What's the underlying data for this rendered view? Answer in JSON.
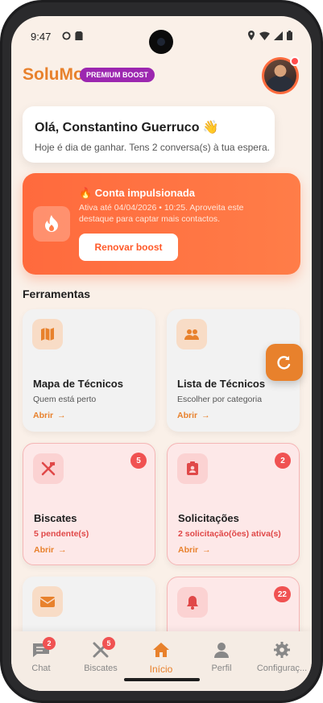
{
  "status_bar": {
    "time": "9:47"
  },
  "header": {
    "brand": "SoluMo",
    "badge": "PREMIUM BOOST"
  },
  "greeting": {
    "title": "Olá, Constantino Guerruco 👋",
    "subtitle": "Hoje é dia de ganhar. Tens 2 conversa(s) à tua espera."
  },
  "boost": {
    "title": "🔥 Conta impulsionada",
    "text": "Ativa até 04/04/2026 • 10:25. Aproveita este destaque para captar mais contactos.",
    "button": "Renovar boost"
  },
  "tools_section": {
    "title": "Ferramentas"
  },
  "tools": [
    {
      "title": "Mapa de Técnicos",
      "subtitle": "Quem está perto",
      "open": "Abrir"
    },
    {
      "title": "Lista de Técnicos",
      "subtitle": "Escolher por categoria",
      "open": "Abrir"
    },
    {
      "title": "Biscates",
      "subtitle": "5 pendente(s)",
      "open": "Abrir",
      "badge": "5"
    },
    {
      "title": "Solicitações",
      "subtitle": "2 solicitação(ões) ativa(s)",
      "open": "Abrir",
      "badge": "2"
    },
    {
      "title": "",
      "subtitle": "",
      "open": ""
    },
    {
      "title": "",
      "subtitle": "",
      "open": "",
      "badge": "22"
    }
  ],
  "bottom_nav": [
    {
      "label": "Chat",
      "badge": "2",
      "icon": "chat-icon"
    },
    {
      "label": "Biscates",
      "badge": "5",
      "icon": "tools-icon"
    },
    {
      "label": "Início",
      "icon": "home-icon",
      "active": true
    },
    {
      "label": "Perfil",
      "icon": "person-icon"
    },
    {
      "label": "Configuraç...",
      "icon": "gear-icon"
    }
  ],
  "colors": {
    "accent": "#e8812c",
    "boost": "#ff6a3d",
    "badge": "#9c27b0",
    "alert": "#f05252"
  }
}
